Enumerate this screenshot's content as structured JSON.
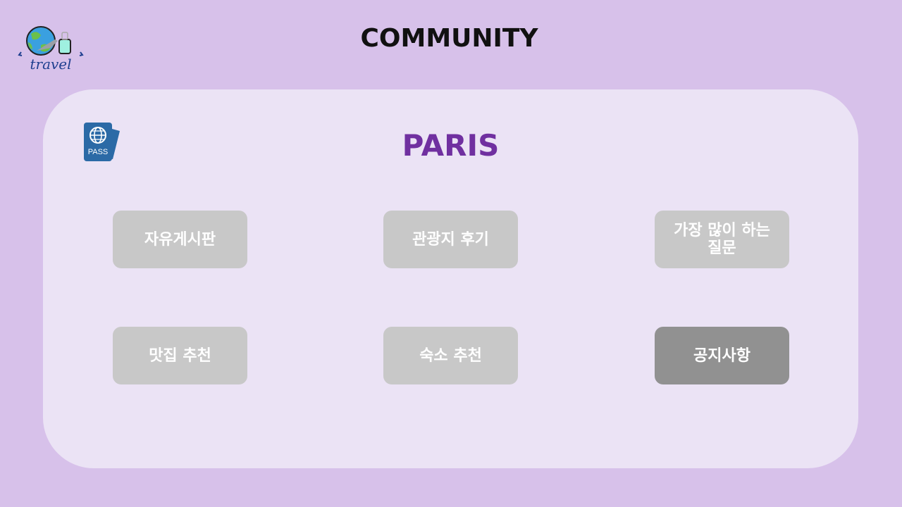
{
  "logo": {
    "text": "travel"
  },
  "header": {
    "title": "COMMUNITY"
  },
  "panel": {
    "passport_label": "PASS",
    "city": "PARIS",
    "menu": [
      {
        "label": "자유게시판",
        "active": false
      },
      {
        "label": "관광지 후기",
        "active": false
      },
      {
        "label": "가장 많이 하는 질문",
        "active": false
      },
      {
        "label": "맛집 추천",
        "active": false
      },
      {
        "label": "숙소 추천",
        "active": false
      },
      {
        "label": "공지사항",
        "active": true
      }
    ]
  },
  "colors": {
    "background": "#d7c1ea",
    "panel": "#ebe3f5",
    "accent": "#7030a0",
    "button": "#c8c8c8",
    "button_active": "#919191",
    "passport": "#2b6aa6"
  }
}
